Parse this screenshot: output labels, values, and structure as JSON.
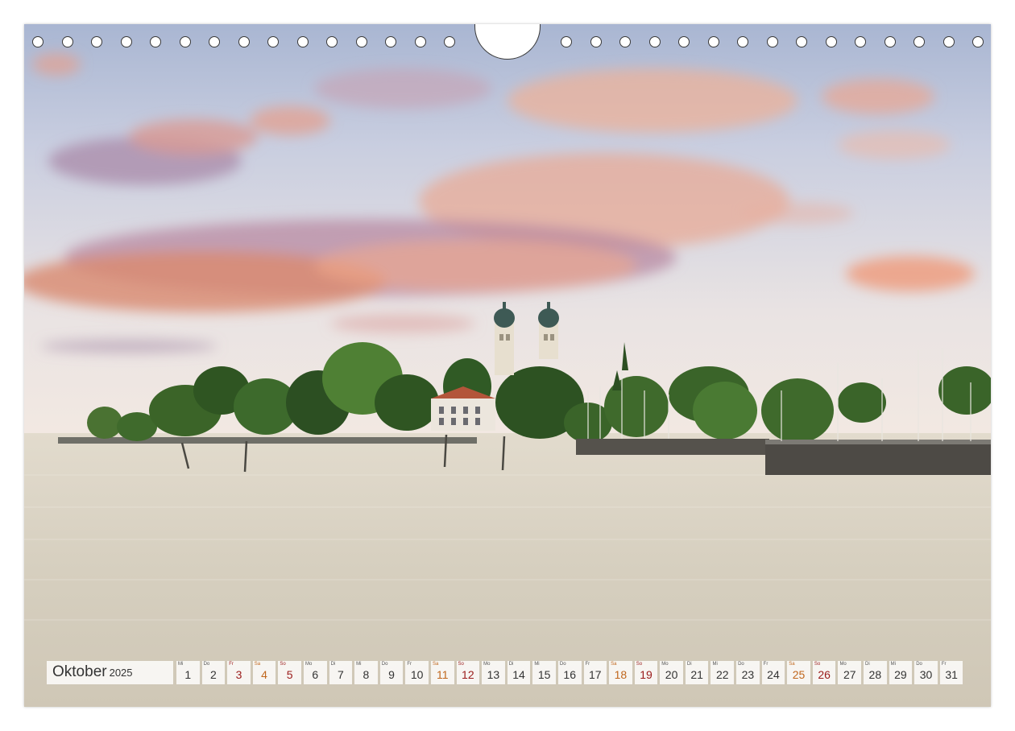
{
  "calendar": {
    "month": "Oktober",
    "year": "2025",
    "days": [
      {
        "wd": "Mi",
        "n": "1",
        "type": "weekday"
      },
      {
        "wd": "Do",
        "n": "2",
        "type": "weekday"
      },
      {
        "wd": "Fr",
        "n": "3",
        "type": "holiday"
      },
      {
        "wd": "Sa",
        "n": "4",
        "type": "sat"
      },
      {
        "wd": "So",
        "n": "5",
        "type": "sun"
      },
      {
        "wd": "Mo",
        "n": "6",
        "type": "weekday"
      },
      {
        "wd": "Di",
        "n": "7",
        "type": "weekday"
      },
      {
        "wd": "Mi",
        "n": "8",
        "type": "weekday"
      },
      {
        "wd": "Do",
        "n": "9",
        "type": "weekday"
      },
      {
        "wd": "Fr",
        "n": "10",
        "type": "weekday"
      },
      {
        "wd": "Sa",
        "n": "11",
        "type": "sat"
      },
      {
        "wd": "So",
        "n": "12",
        "type": "sun"
      },
      {
        "wd": "Mo",
        "n": "13",
        "type": "weekday"
      },
      {
        "wd": "Di",
        "n": "14",
        "type": "weekday"
      },
      {
        "wd": "Mi",
        "n": "15",
        "type": "weekday"
      },
      {
        "wd": "Do",
        "n": "16",
        "type": "weekday"
      },
      {
        "wd": "Fr",
        "n": "17",
        "type": "weekday"
      },
      {
        "wd": "Sa",
        "n": "18",
        "type": "sat"
      },
      {
        "wd": "So",
        "n": "19",
        "type": "sun"
      },
      {
        "wd": "Mo",
        "n": "20",
        "type": "weekday"
      },
      {
        "wd": "Di",
        "n": "21",
        "type": "weekday"
      },
      {
        "wd": "Mi",
        "n": "22",
        "type": "weekday"
      },
      {
        "wd": "Do",
        "n": "23",
        "type": "weekday"
      },
      {
        "wd": "Fr",
        "n": "24",
        "type": "weekday"
      },
      {
        "wd": "Sa",
        "n": "25",
        "type": "sat"
      },
      {
        "wd": "So",
        "n": "26",
        "type": "sun"
      },
      {
        "wd": "Mo",
        "n": "27",
        "type": "weekday"
      },
      {
        "wd": "Di",
        "n": "28",
        "type": "weekday"
      },
      {
        "wd": "Mi",
        "n": "29",
        "type": "weekday"
      },
      {
        "wd": "Do",
        "n": "30",
        "type": "weekday"
      },
      {
        "wd": "Fr",
        "n": "31",
        "type": "weekday"
      }
    ]
  },
  "colors": {
    "sky_top": "#aab8d4",
    "cloud_pink": "#e8a28c",
    "water": "#d9d2c3",
    "trees": "#3f6a2c",
    "saturday": "#c0661c",
    "sunday_holiday": "#9a1a1a"
  },
  "binding": {
    "hole_count_left": 15,
    "hole_count_right": 15
  }
}
